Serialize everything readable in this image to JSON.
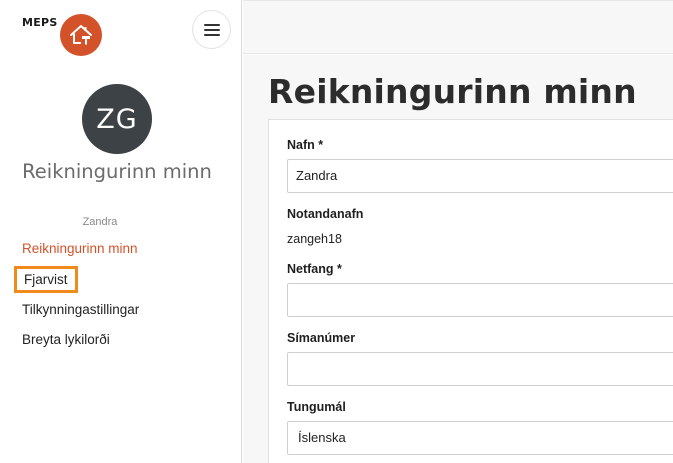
{
  "brand": {
    "name": "MEPS",
    "logo_icon": "house-hammer-icon",
    "logo_color": "#d4522a"
  },
  "menu_icon": "hamburger-icon",
  "profile": {
    "initials": "ZG",
    "title": "Reikningurinn minn",
    "name": "Zandra"
  },
  "nav": {
    "items": [
      {
        "label": "Reikningurinn minn",
        "active": true
      },
      {
        "label": "Fjarvist",
        "highlighted": true
      },
      {
        "label": "Tilkynningastillingar"
      },
      {
        "label": "Breyta lykilorði"
      }
    ]
  },
  "main": {
    "title": "Reikningurinn minn",
    "form": {
      "name_label": "Nafn *",
      "name_value": "Zandra",
      "username_label": "Notandanafn",
      "username_value": "zangeh18",
      "email_label": "Netfang *",
      "email_value": "",
      "phone_label": "Símanúmer",
      "phone_value": "",
      "language_label": "Tungumál",
      "language_value": "Íslenska"
    }
  },
  "colors": {
    "accent": "#d4522a",
    "highlight": "#f08a1c",
    "avatar_bg": "#3d4246"
  }
}
